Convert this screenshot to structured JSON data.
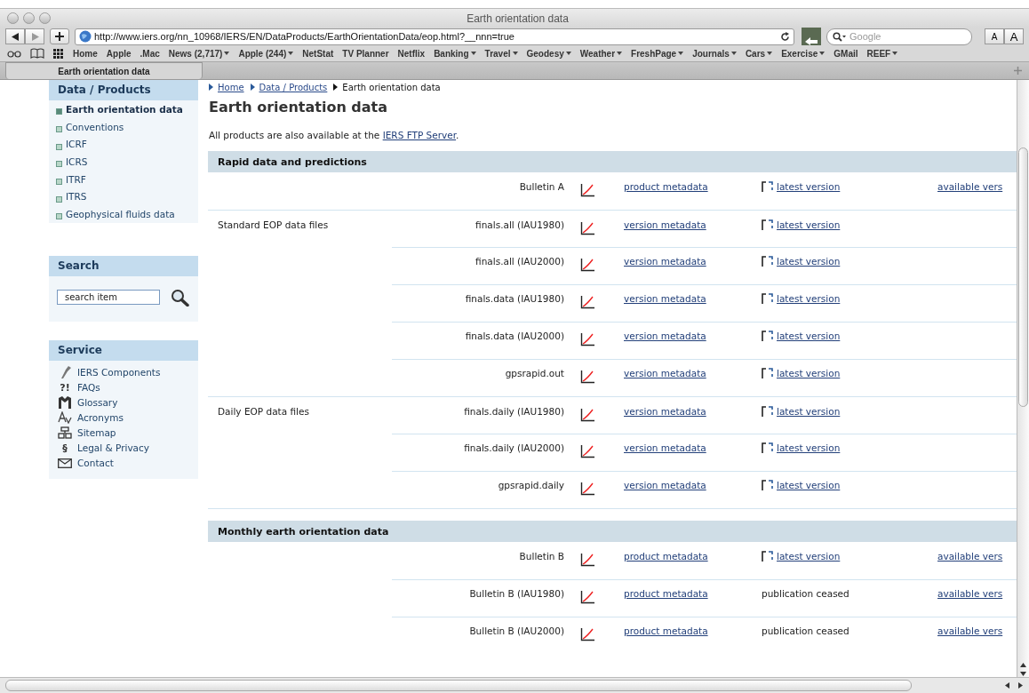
{
  "window": {
    "title": "Earth orientation data"
  },
  "toolbar": {
    "url": "http://www.iers.org/nn_10968/IERS/EN/DataProducts/EarthOrientationData/eop.html?__nnn=true",
    "search_placeholder": "Google",
    "text_smaller": "A",
    "text_larger": "A"
  },
  "bookmarks": [
    {
      "label": "Home",
      "menu": false
    },
    {
      "label": "Apple",
      "menu": false
    },
    {
      "label": ".Mac",
      "menu": false
    },
    {
      "label": "News (2,717)",
      "menu": true
    },
    {
      "label": "Apple (244)",
      "menu": true
    },
    {
      "label": "NetStat",
      "menu": false
    },
    {
      "label": "TV Planner",
      "menu": false
    },
    {
      "label": "Netflix",
      "menu": false
    },
    {
      "label": "Banking",
      "menu": true
    },
    {
      "label": "Travel",
      "menu": true
    },
    {
      "label": "Geodesy",
      "menu": true
    },
    {
      "label": "Weather",
      "menu": true
    },
    {
      "label": "FreshPage",
      "menu": true
    },
    {
      "label": "Journals",
      "menu": true
    },
    {
      "label": "Cars",
      "menu": true
    },
    {
      "label": "Exercise",
      "menu": true
    },
    {
      "label": "GMail",
      "menu": false
    },
    {
      "label": "REEF",
      "menu": true
    }
  ],
  "tabs": [
    {
      "label": "Earth orientation data",
      "selected": true
    }
  ],
  "sidebar": {
    "nav_title": "Data / Products",
    "nav_items": [
      {
        "label": "Earth orientation data",
        "selected": true
      },
      {
        "label": "Conventions",
        "selected": false
      },
      {
        "label": "ICRF",
        "selected": false
      },
      {
        "label": "ICRS",
        "selected": false
      },
      {
        "label": "ITRF",
        "selected": false
      },
      {
        "label": "ITRS",
        "selected": false
      },
      {
        "label": "Geophysical fluids data",
        "selected": false
      }
    ],
    "search_title": "Search",
    "search_value": "search item",
    "service_title": "Service",
    "service_items": [
      {
        "label": "IERS Components",
        "kind": "components"
      },
      {
        "label": "FAQs",
        "kind": "glyph",
        "glyph": "?!"
      },
      {
        "label": "Glossary",
        "kind": "glossary"
      },
      {
        "label": "Acronyms",
        "kind": "acronyms"
      },
      {
        "label": "Sitemap",
        "kind": "sitemap"
      },
      {
        "label": "Legal & Privacy",
        "kind": "glyph",
        "glyph": "§"
      },
      {
        "label": "Contact",
        "kind": "contact"
      }
    ]
  },
  "breadcrumb": [
    {
      "label": "Home",
      "link": true
    },
    {
      "label": "Data / Products",
      "link": true
    },
    {
      "label": "Earth orientation data",
      "link": false
    }
  ],
  "heading": "Earth orientation data",
  "intro": {
    "text": "All products are also available at the ",
    "link": "IERS FTP Server",
    "end": "."
  },
  "sections": [
    {
      "title": "Rapid data and predictions",
      "rows": [
        {
          "group": "",
          "name": "Bulletin A",
          "metadata": "product metadata",
          "latest": {
            "kind": "link",
            "text": "latest version"
          },
          "available": "available vers"
        },
        {
          "group": "Standard EOP data files",
          "name": "finals.all (IAU1980)",
          "metadata": "version metadata",
          "latest": {
            "kind": "link",
            "text": "latest version"
          },
          "available": ""
        },
        {
          "group": "",
          "name": "finals.all (IAU2000)",
          "metadata": "version metadata",
          "latest": {
            "kind": "link",
            "text": "latest version"
          },
          "available": ""
        },
        {
          "group": "",
          "name": "finals.data (IAU1980)",
          "metadata": "version metadata",
          "latest": {
            "kind": "link",
            "text": "latest version"
          },
          "available": ""
        },
        {
          "group": "",
          "name": "finals.data (IAU2000)",
          "metadata": "version metadata",
          "latest": {
            "kind": "link",
            "text": "latest version"
          },
          "available": ""
        },
        {
          "group": "",
          "name": "gpsrapid.out",
          "metadata": "version metadata",
          "latest": {
            "kind": "link",
            "text": "latest version"
          },
          "available": ""
        },
        {
          "group": "Daily EOP data files",
          "name": "finals.daily (IAU1980)",
          "metadata": "version metadata",
          "latest": {
            "kind": "link",
            "text": "latest version"
          },
          "available": ""
        },
        {
          "group": "",
          "name": "finals.daily (IAU2000)",
          "metadata": "version metadata",
          "latest": {
            "kind": "link",
            "text": "latest version"
          },
          "available": ""
        },
        {
          "group": "",
          "name": "gpsrapid.daily",
          "metadata": "version metadata",
          "latest": {
            "kind": "link",
            "text": "latest version"
          },
          "available": ""
        }
      ]
    },
    {
      "title": "Monthly earth orientation data",
      "rows": [
        {
          "group": "",
          "name": "Bulletin B",
          "metadata": "product metadata",
          "latest": {
            "kind": "link",
            "text": "latest version"
          },
          "available": "available vers"
        },
        {
          "group": "",
          "name": "Bulletin B (IAU1980)",
          "metadata": "product metadata",
          "latest": {
            "kind": "text",
            "text": "publication ceased"
          },
          "available": "available vers"
        },
        {
          "group": "",
          "name": "Bulletin B (IAU2000)",
          "metadata": "product metadata",
          "latest": {
            "kind": "text",
            "text": "publication ceased"
          },
          "available": "available vers"
        }
      ]
    }
  ]
}
